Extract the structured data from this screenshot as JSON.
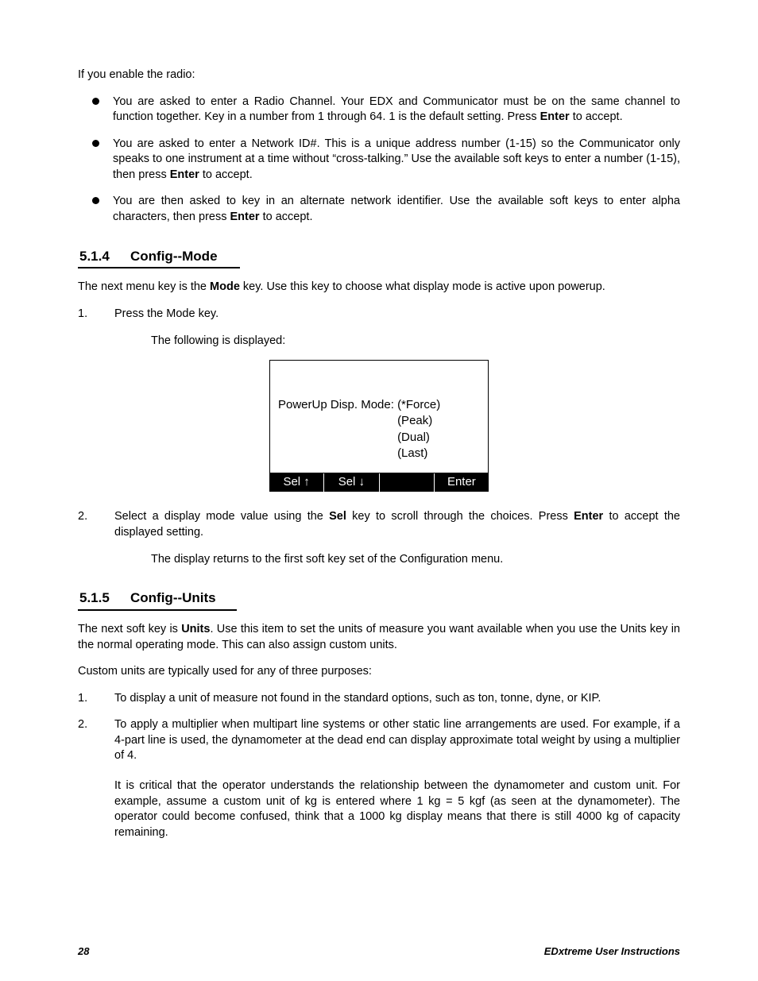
{
  "intro": "If you enable the radio:",
  "bullets": [
    {
      "pre": "You are asked to enter a Radio Channel. Your EDX and Communicator must be on the same channel to function together. Key in a number from 1 through 64. 1 is the default setting. Press ",
      "bold": "Enter",
      "post": " to accept."
    },
    {
      "pre": "You are asked to enter a Network ID#. This is a unique address number (1-15) so the Communicator only speaks to one instrument at a time without “cross-talking.” Use the available soft keys to enter a number (1-15), then press ",
      "bold": "Enter",
      "post": " to accept."
    },
    {
      "pre": "You are then asked to key in an alternate network identifier. Use the available soft keys to enter alpha characters, then press ",
      "bold": "Enter",
      "post": " to accept."
    }
  ],
  "s514": {
    "num": "5.1.4",
    "title": "Config--Mode",
    "intro_pre": "The next menu key is the ",
    "intro_bold": "Mode",
    "intro_post": " key. Use this key to choose what display mode is active upon powerup.",
    "step1": {
      "n": "1.",
      "text": "Press the Mode key.",
      "sub": "The following is displayed:"
    },
    "display": {
      "label": "PowerUp Disp. Mode: ",
      "vals": [
        "(*Force)",
        "(Peak)",
        "(Dual)",
        "(Last)"
      ],
      "softkeys": [
        "Sel ↑",
        "Sel ↓",
        "",
        "Enter"
      ]
    },
    "step2": {
      "n": "2.",
      "pre": "Select a display mode value using the ",
      "b1": "Sel",
      "mid": " key to scroll through the choices. Press ",
      "b2": "Enter",
      "post": " to accept the displayed setting.",
      "sub": "The display returns to the first soft key set of the Configuration menu."
    }
  },
  "s515": {
    "num": "5.1.5",
    "title": "Config--Units",
    "intro_pre": "The next soft key is ",
    "intro_bold": "Units",
    "intro_post": ". Use this item to set the units of measure you want available when you use the Units key in the normal operating mode. This can also assign custom units.",
    "p2": "Custom units are typically used for any of three purposes:",
    "items": [
      {
        "n": "1.",
        "text": "To display a unit of measure not found in the standard options, such as ton, tonne, dyne, or KIP."
      },
      {
        "n": "2.",
        "text": "To apply a multiplier when multipart line systems or other static line arrangements are used. For example, if a 4-part line is used, the dynamometer at the dead end can display approximate total weight by using a multiplier of 4.",
        "extra": "It is critical that the operator understands the relationship between the dynamometer and custom unit. For example, assume a custom unit of kg is entered where 1 kg = 5 kgf (as seen at the dynamometer). The operator could become confused, think that a 1000 kg display means that there is still 4000 kg of capacity remaining."
      }
    ]
  },
  "footer": {
    "page": "28",
    "title": "EDxtreme User Instructions"
  }
}
